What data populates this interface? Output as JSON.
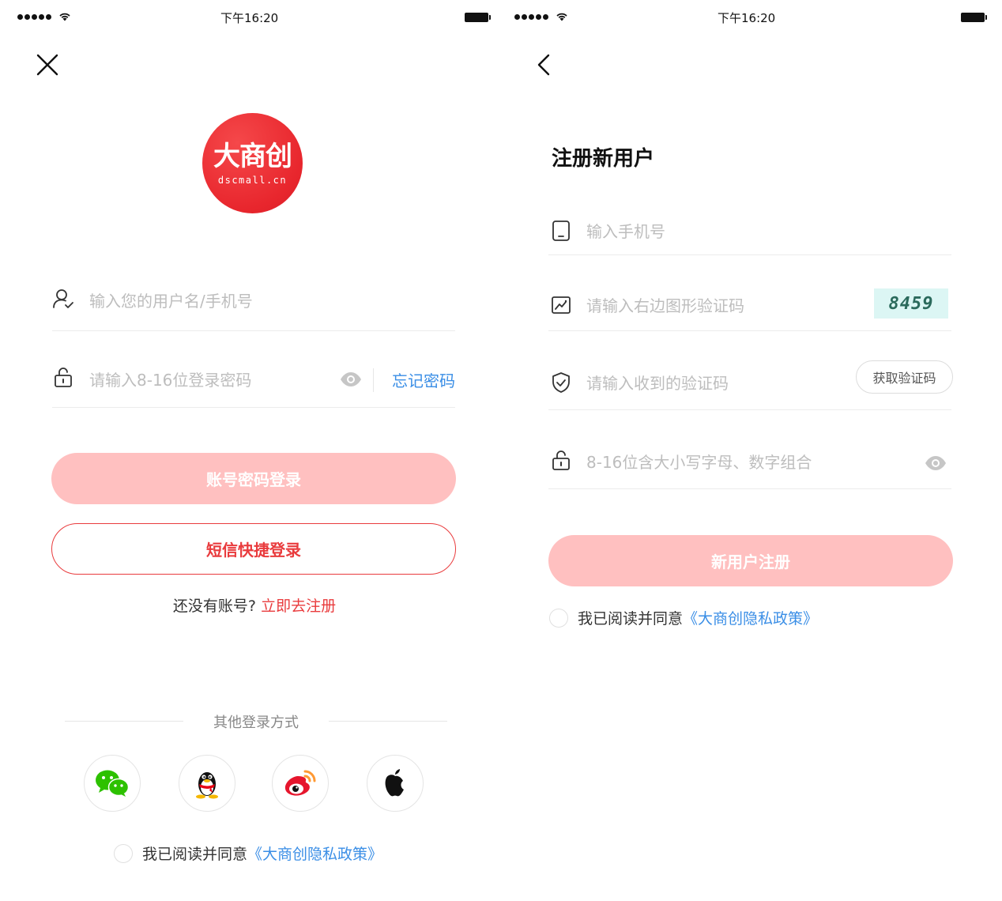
{
  "status_bar": {
    "time": "下午16:20"
  },
  "login": {
    "logo": {
      "text_cn": "大商创",
      "text_en": "dscmall.cn"
    },
    "username": {
      "placeholder": "输入您的用户名/手机号"
    },
    "password": {
      "placeholder": "请输入8-16位登录密码",
      "forgot_label": "忘记密码"
    },
    "primary_button": "账号密码登录",
    "sms_button": "短信快捷登录",
    "register_prompt": "还没有账号?",
    "register_link": "立即去注册",
    "other_methods": "其他登录方式",
    "social": [
      "wechat",
      "qq",
      "weibo",
      "apple"
    ],
    "agree_text": "我已阅读并同意",
    "agree_link": "《大商创隐私政策》"
  },
  "register": {
    "title": "注册新用户",
    "phone": {
      "placeholder": "输入手机号"
    },
    "captcha": {
      "placeholder": "请输入右边图形验证码",
      "code": "8459"
    },
    "sms_code": {
      "placeholder": "请输入收到的验证码",
      "button": "获取验证码"
    },
    "password": {
      "placeholder": "8-16位含大小写字母、数字组合"
    },
    "submit_button": "新用户注册",
    "agree_text": "我已阅读并同意",
    "agree_link": "《大商创隐私政策》"
  },
  "colors": {
    "accent_red": "#e93b3d",
    "button_pink": "#ffc0c0",
    "link_blue": "#3a8ee6",
    "logo_red": "#e8262d"
  }
}
